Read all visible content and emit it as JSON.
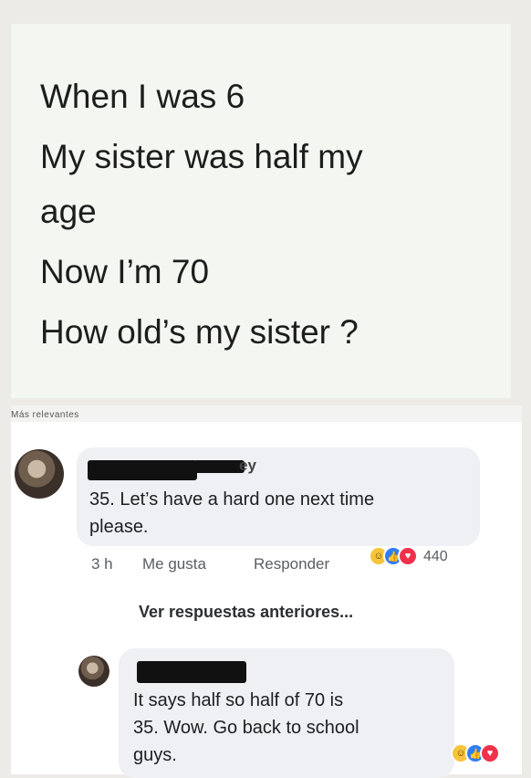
{
  "post": {
    "lines": [
      "When I was 6",
      "My sister was half my",
      "age",
      "Now I’m 70",
      "How old’s my sister ?"
    ]
  },
  "filter_bar": {
    "text": "Más relevantes"
  },
  "comments": [
    {
      "author_visible_fragment": "ey",
      "text_lines": [
        "35. Let’s have a hard one next time",
        "please."
      ],
      "time": "3 h",
      "like_label": "Me gusta",
      "reply_label": "Responder",
      "reactions": [
        "haha-icon",
        "like-icon",
        "love-icon"
      ],
      "reaction_count": "440"
    }
  ],
  "more_replies_label": "Ver respuestas anteriores...",
  "reply": {
    "text_lines": [
      "It says half so half of 70 is",
      "35. Wow. Go back to school",
      "guys."
    ],
    "reactions": [
      "haha-icon",
      "like-icon",
      "love-icon"
    ]
  },
  "colors": {
    "like": "#2f7df6",
    "love": "#f0314c",
    "haha": "#f7c53b",
    "bubble": "#eef0f3"
  }
}
